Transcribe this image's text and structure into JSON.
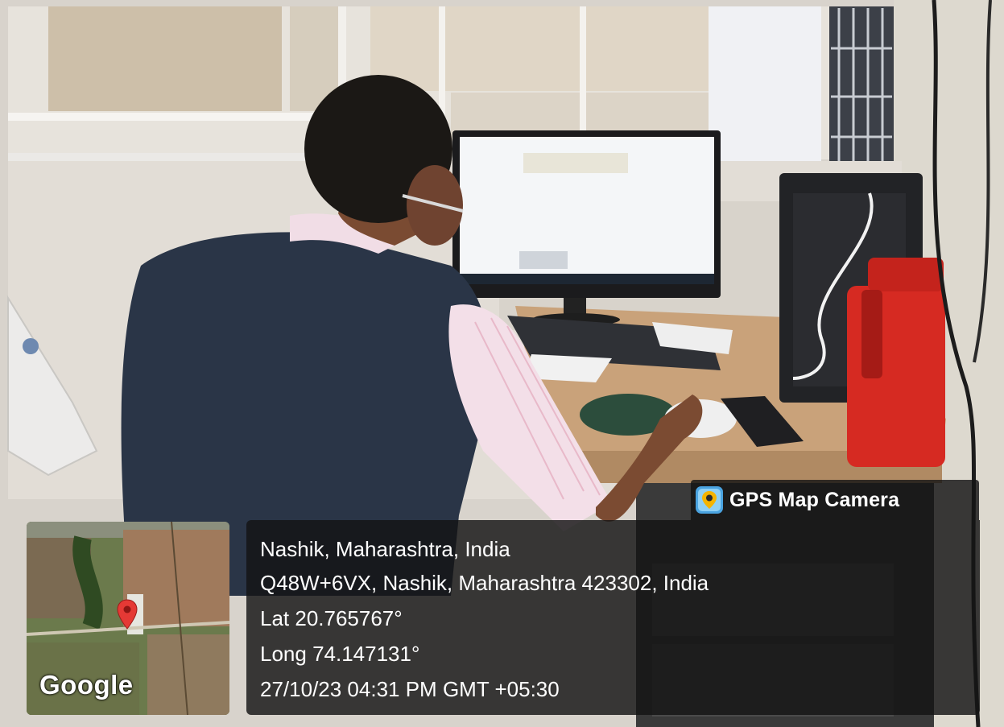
{
  "overlay": {
    "app_name": "GPS Map Camera",
    "app_icon": "map-pin-camera-icon",
    "location_title": "Nashik, Maharashtra, India",
    "address": "Q48W+6VX, Nashik, Maharashtra 423302, India",
    "latitude": "Lat 20.765767°",
    "longitude": "Long 74.147131°",
    "datetime": "27/10/23 04:31 PM GMT +05:30",
    "map_attribution": "Google",
    "map_marker_icon": "map-pin-icon"
  },
  "colors": {
    "overlay_bg": "#141414",
    "overlay_text": "#ffffff",
    "marker_red": "#e53935",
    "bottle_red": "#d62a22",
    "vest_navy": "#2a3547"
  }
}
